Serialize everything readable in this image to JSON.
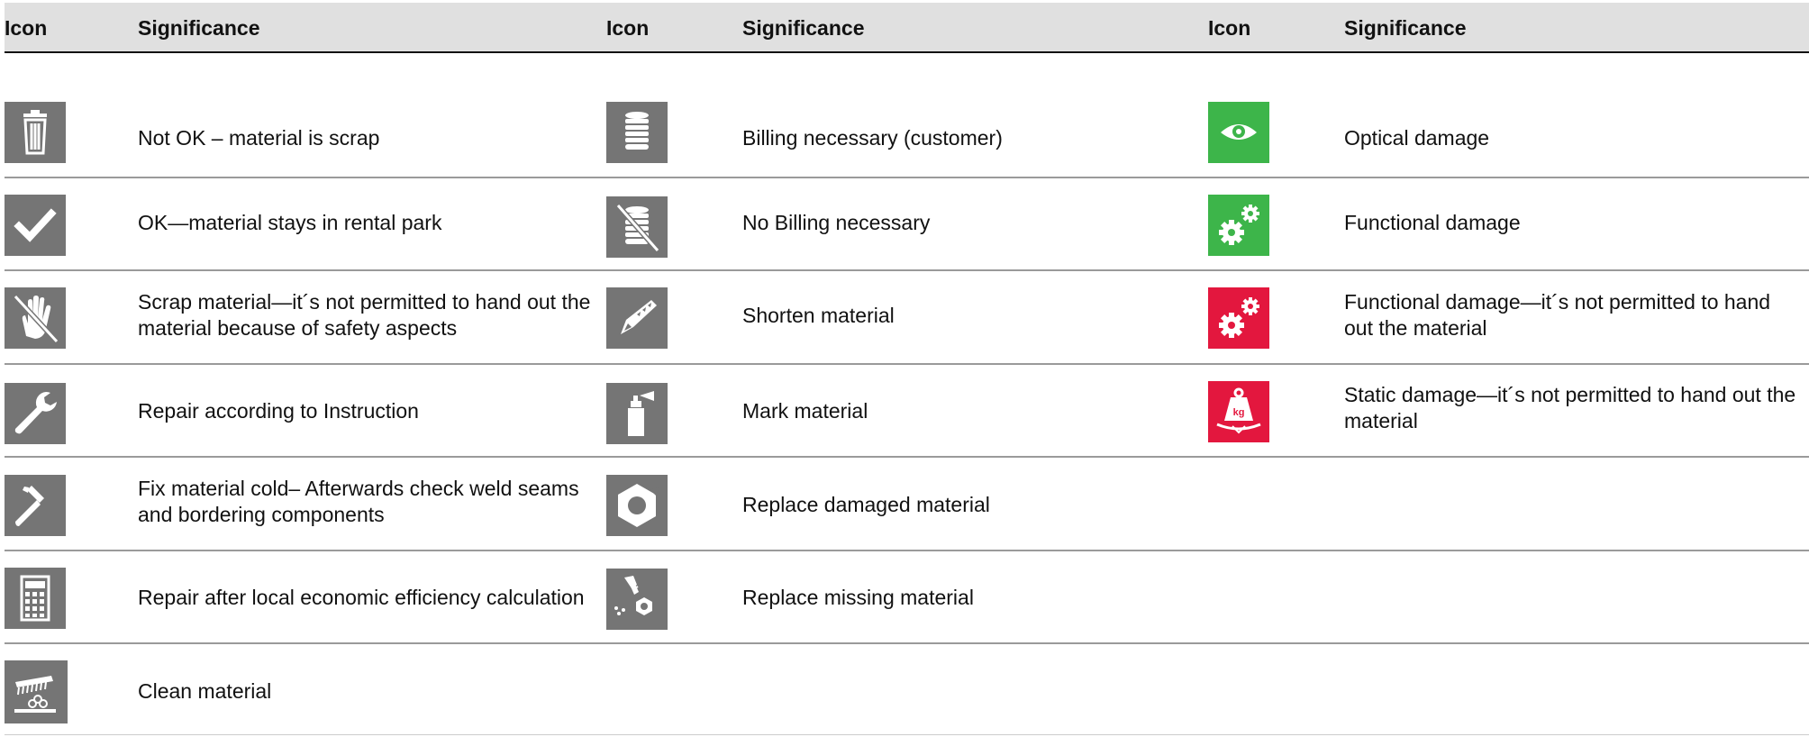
{
  "header": {
    "col1_icon": "Icon",
    "col1_significance": "Significance",
    "col2_icon": "Icon",
    "col2_significance": "Significance",
    "col3_icon": "Icon",
    "col3_significance": "Significance"
  },
  "colors": {
    "grey_icon": "#757575",
    "green_icon": "#3db54a",
    "red_icon": "#e3173e",
    "header_bg": "#e0e0e0"
  },
  "column1": [
    {
      "icon": "trash-can-icon",
      "text": "Not OK – material is scrap"
    },
    {
      "icon": "checkmark-icon",
      "text": "OK—material stays in rental park"
    },
    {
      "icon": "crossed-out-hand-icon",
      "text": "Scrap material—it´s not permitted to hand out the material because of safety aspects"
    },
    {
      "icon": "wrench-icon",
      "text": "Repair according to Instruction"
    },
    {
      "icon": "hammer-icon",
      "text": "Fix material cold– Afterwards check weld seams and bordering components"
    },
    {
      "icon": "calculator-icon",
      "text": "Repair after local economic efficiency calculation"
    },
    {
      "icon": "cleaning-brush-icon",
      "text": "Clean material"
    }
  ],
  "column2": [
    {
      "icon": "coin-stack-icon",
      "text": "Billing necessary (customer)"
    },
    {
      "icon": "crossed-coin-stack-icon",
      "text": "No Billing necessary"
    },
    {
      "icon": "saw-icon",
      "text": "Shorten material"
    },
    {
      "icon": "spray-can-icon",
      "text": "Mark material"
    },
    {
      "icon": "damaged-nut-icon",
      "text": "Replace damaged material"
    },
    {
      "icon": "bolt-and-nut-icon",
      "text": "Replace missing material"
    }
  ],
  "column3": [
    {
      "icon": "eye-icon",
      "text": "Optical damage",
      "color": "green"
    },
    {
      "icon": "gears-icon",
      "text": "Functional damage",
      "color": "green"
    },
    {
      "icon": "gears-icon",
      "text": "Functional damage—it´s not permitted to hand out the material",
      "color": "red"
    },
    {
      "icon": "weight-kg-icon",
      "text": "Static damage—it´s not permitted to hand out the material",
      "color": "red",
      "weight_label": "kg"
    }
  ]
}
